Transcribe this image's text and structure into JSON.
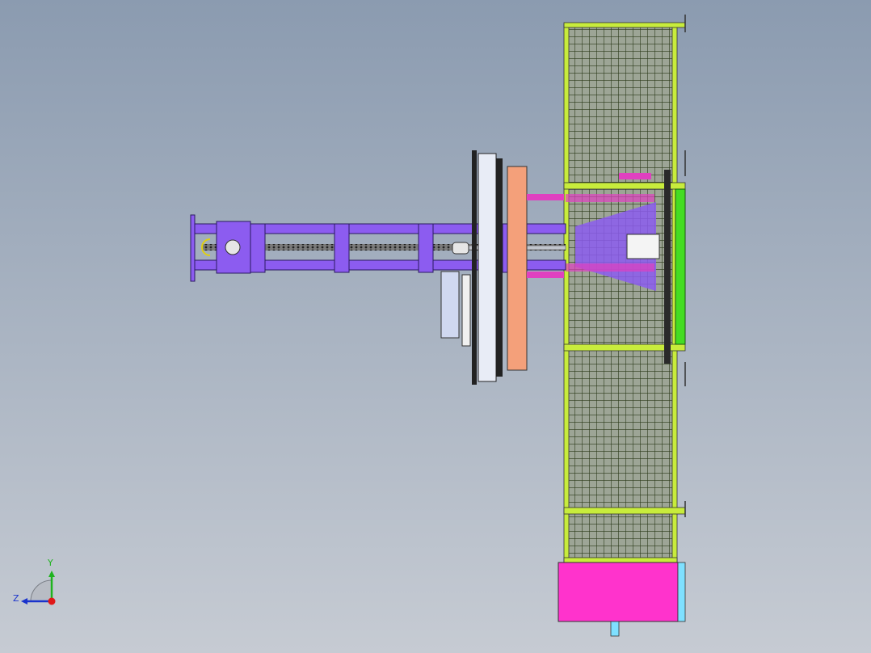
{
  "viewport": {
    "background_top": "#8b9bb0",
    "background_bottom": "#c6cbd3"
  },
  "model": {
    "frame_color": "#c8ec3c",
    "mesh_color": "#2c3a1a",
    "arm_color": "#8c5cf0",
    "cabinet_color": "#ff33cc",
    "disc_color": "#f4a07a",
    "cylinder_color": "#e040c0",
    "panel_color": "#d0d8f0",
    "side_panel_color": "#7fe0ff",
    "green_rail_color": "#44dd22"
  },
  "triad": {
    "y_label": "Y",
    "z_label": "Z",
    "y_color": "#1fb31f",
    "z_color": "#1a33cc",
    "origin_color": "#e01818"
  }
}
